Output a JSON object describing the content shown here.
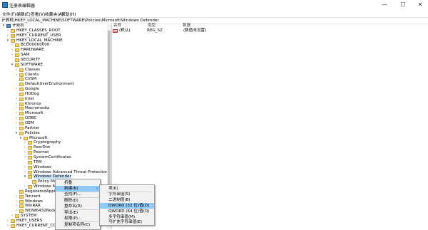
{
  "window": {
    "title": "注册表编辑器",
    "minimize": "—",
    "maximize": "☐",
    "close": "✕"
  },
  "menu": [
    "文件(F)",
    "编辑(E)",
    "查看(V)",
    "收藏夹(A)",
    "帮助(H)"
  ],
  "address": "计算机\\HKEY_LOCAL_MACHINE\\SOFTWARE\\Policies\\Microsoft\\Windows Defender",
  "columns": {
    "name": "名称",
    "type": "类型",
    "data": "数据"
  },
  "values": [
    {
      "icon": "ab",
      "name": "(默认)",
      "type": "REG_SZ",
      "data": "(数值未设置)"
    }
  ],
  "tree": [
    {
      "label": "计算机",
      "arrow": "▾",
      "icon": "computer"
    },
    {
      "label": "HKEY_CLASSES_ROOT",
      "arrow": "›",
      "icon": "folder"
    },
    {
      "label": "HKEY_CURRENT_USER",
      "arrow": "›",
      "icon": "folder"
    },
    {
      "label": "HKEY_LOCAL_MACHINE",
      "arrow": "▾",
      "icon": "folder"
    },
    {
      "label": "BCD00000000",
      "arrow": "›",
      "icon": "folder"
    },
    {
      "label": "HARDWARE",
      "arrow": "›",
      "icon": "folder"
    },
    {
      "label": "SAM",
      "arrow": "›",
      "icon": "folder"
    },
    {
      "label": "SECURITY",
      "arrow": "",
      "icon": "folder"
    },
    {
      "label": "SOFTWARE",
      "arrow": "▾",
      "icon": "folder"
    },
    {
      "label": "Classes",
      "arrow": "›",
      "icon": "folder"
    },
    {
      "label": "Clients",
      "arrow": "›",
      "icon": "folder"
    },
    {
      "label": "CVSM",
      "arrow": "",
      "icon": "folder"
    },
    {
      "label": "DefaultUserEnvironment",
      "arrow": "",
      "icon": "folder"
    },
    {
      "label": "Google",
      "arrow": "›",
      "icon": "folder"
    },
    {
      "label": "HODog",
      "arrow": "",
      "icon": "folder"
    },
    {
      "label": "Intel",
      "arrow": "›",
      "icon": "folder"
    },
    {
      "label": "Khronos",
      "arrow": "›",
      "icon": "folder"
    },
    {
      "label": "Macromedia",
      "arrow": "›",
      "icon": "folder"
    },
    {
      "label": "Microsoft",
      "arrow": "›",
      "icon": "folder"
    },
    {
      "label": "ODBC",
      "arrow": "›",
      "icon": "folder"
    },
    {
      "label": "OEM",
      "arrow": "›",
      "icon": "folder"
    },
    {
      "label": "Partner",
      "arrow": "›",
      "icon": "folder"
    },
    {
      "label": "Policies",
      "arrow": "▾",
      "icon": "folder"
    },
    {
      "label": "Microsoft",
      "arrow": "▾",
      "icon": "folder"
    },
    {
      "label": "Cryptography",
      "arrow": "›",
      "icon": "folder"
    },
    {
      "label": "PeerDist",
      "arrow": "›",
      "icon": "folder"
    },
    {
      "label": "Peernet",
      "arrow": "›",
      "icon": "folder"
    },
    {
      "label": "SystemCertificates",
      "arrow": "›",
      "icon": "folder"
    },
    {
      "label": "TPM",
      "arrow": "",
      "icon": "folder"
    },
    {
      "label": "Windows",
      "arrow": "›",
      "icon": "folder"
    },
    {
      "label": "Windows Advanced Threat Protection",
      "arrow": "›",
      "icon": "folder"
    },
    {
      "label": "Windows Defender",
      "arrow": "▾",
      "icon": "folder"
    },
    {
      "label": "Policy Manager",
      "arrow": "",
      "icon": "folder"
    },
    {
      "label": "Windows NT",
      "arrow": "›",
      "icon": "folder"
    },
    {
      "label": "RegisteredApplications",
      "arrow": "",
      "icon": "folder"
    },
    {
      "label": "Tencent",
      "arrow": "›",
      "icon": "folder"
    },
    {
      "label": "Windows",
      "arrow": "›",
      "icon": "folder"
    },
    {
      "label": "WinRAR",
      "arrow": "›",
      "icon": "folder"
    },
    {
      "label": "WOW6432Node",
      "arrow": "›",
      "icon": "folder"
    },
    {
      "label": "SYSTEM",
      "arrow": "›",
      "icon": "folder"
    },
    {
      "label": "HKEY_USERS",
      "arrow": "›",
      "icon": "folder"
    },
    {
      "label": "HKEY_CURRENT_CONFIG",
      "arrow": "›",
      "icon": "folder"
    }
  ],
  "context_menu": {
    "items": [
      "折叠",
      "新建(N)",
      "查找(F)...",
      "删除(D)",
      "重命名(R)",
      "导出(E)",
      "权限(P)...",
      "复制项名称(C)"
    ],
    "submenu_arrow": "›"
  },
  "submenu": {
    "items": [
      "项(K)",
      "字符串值(S)",
      "二进制值(B)",
      "DWORD (32 位)值(D)",
      "QWORD (64 位)值(Q)",
      "多字符串值(M)",
      "可扩充字符串值(E)"
    ]
  }
}
